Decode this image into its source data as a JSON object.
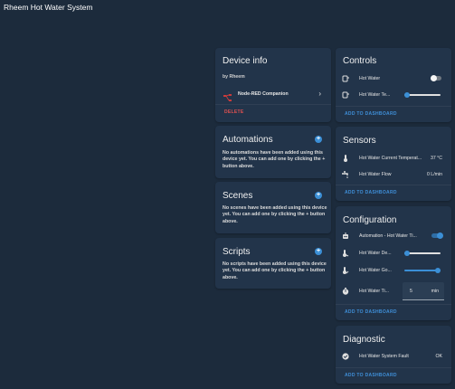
{
  "header": {
    "title": "Rheem Hot Water System"
  },
  "device_info": {
    "title": "Device info",
    "manufacturer": "by Rheem",
    "integration": "Node-RED Companion",
    "delete_label": "DELETE",
    "icon": "node-red-icon"
  },
  "automations": {
    "title": "Automations",
    "description": "No automations have been added using this device yet. You can add one by clicking the + button above."
  },
  "scenes": {
    "title": "Scenes",
    "description": "No scenes have been added using this device yet. You can add one by clicking the + button above."
  },
  "scripts": {
    "title": "Scripts",
    "description": "No scripts have been added using this device yet. You can add one by clicking the + button above."
  },
  "controls": {
    "title": "Controls",
    "rows": [
      {
        "label": "Hot Water",
        "type": "toggle",
        "state": "off",
        "icon": "water-boiler-icon"
      },
      {
        "label": "Hot Water Te...",
        "type": "slider",
        "level": 0.0,
        "icon": "water-boiler-icon"
      }
    ],
    "action": "ADD TO DASHBOARD"
  },
  "sensors": {
    "title": "Sensors",
    "rows": [
      {
        "label": "Hot Water Current Temperat...",
        "value": "37 °C",
        "icon": "thermometer-icon"
      },
      {
        "label": "Hot Water Flow",
        "value": "0 L/min",
        "icon": "faucet-icon"
      }
    ],
    "action": "ADD TO DASHBOARD"
  },
  "configuration": {
    "title": "Configuration",
    "rows": [
      {
        "label": "Automation - Hot Water Ti...",
        "type": "toggle",
        "state": "on",
        "icon": "robot-icon"
      },
      {
        "label": "Hot Water De...",
        "type": "slider",
        "level": 0.0,
        "icon": "thermometer-low-icon"
      },
      {
        "label": "Hot Water Go...",
        "type": "slider",
        "level": 1.0,
        "icon": "thermometer-high-icon"
      },
      {
        "label": "Hot Water Ti...",
        "type": "number",
        "value": "5",
        "unit": "min",
        "icon": "timer-icon"
      }
    ],
    "action": "ADD TO DASHBOARD"
  },
  "diagnostic": {
    "title": "Diagnostic",
    "rows": [
      {
        "label": "Hot Water System Fault",
        "value": "OK",
        "icon": "check-circle-icon"
      }
    ],
    "action": "ADD TO DASHBOARD"
  },
  "colors": {
    "background": "#1c2b3c",
    "card": "#22344a",
    "accent": "#3b8fd6",
    "delete": "#e05151"
  }
}
